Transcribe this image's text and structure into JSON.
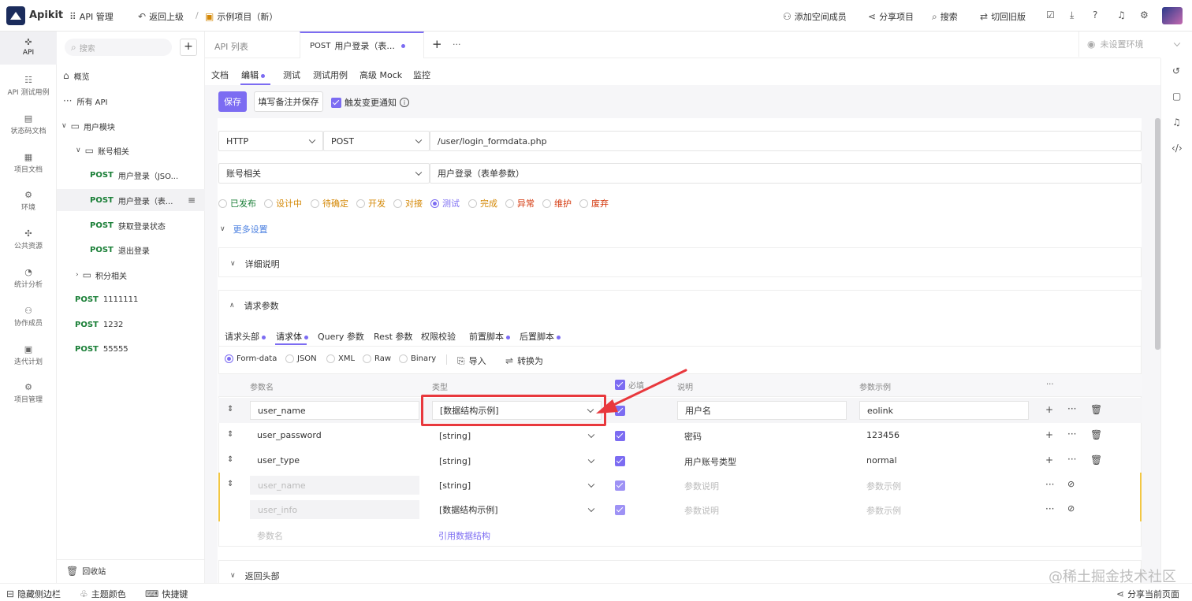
{
  "app": {
    "name": "Apikit"
  },
  "topbar": {
    "api_manage": "API 管理",
    "back": "返回上级",
    "separator": "/",
    "project": "示例项目（新）",
    "add_member": "添加空间成员",
    "share": "分享项目",
    "search": "搜索",
    "old_version": "切回旧版"
  },
  "rail": [
    {
      "label": "API",
      "icon": "api-icon"
    },
    {
      "label": "API 测试用例",
      "icon": "test-case-icon"
    },
    {
      "label": "状态码文档",
      "icon": "doc-icon"
    },
    {
      "label": "项目文档",
      "icon": "word-icon"
    },
    {
      "label": "环境",
      "icon": "env-icon"
    },
    {
      "label": "公共资源",
      "icon": "puzzle-icon"
    },
    {
      "label": "统计分析",
      "icon": "pie-chart-icon"
    },
    {
      "label": "协作成员",
      "icon": "users-icon"
    },
    {
      "label": "迭代计划",
      "icon": "calendar-icon"
    },
    {
      "label": "项目管理",
      "icon": "gear-icon"
    }
  ],
  "tree": {
    "search_placeholder": "搜索",
    "overview": "概览",
    "all_api": "所有 API",
    "user_module": "用户模块",
    "account": "账号相关",
    "method": "POST",
    "items": [
      "用户登录（JSO...",
      "用户登录（表...",
      "获取登录状态",
      "退出登录"
    ],
    "points": "积分相关",
    "root_items": [
      "1111111",
      "1232",
      "55555"
    ],
    "recycle": "回收站"
  },
  "tabs": {
    "api_list": "API 列表",
    "active_method": "POST",
    "active_title": "用户登录（表...",
    "plus": "+",
    "more": "···",
    "env": "未设置环境"
  },
  "subtabs": [
    "文档",
    "编辑",
    "测试",
    "测试用例",
    "高级 Mock",
    "监控"
  ],
  "actions": {
    "save": "保存",
    "save_note": "填写备注并保存",
    "notify": "触发变更通知"
  },
  "request": {
    "protocol": "HTTP",
    "method": "POST",
    "url": "/user/login_formdata.php",
    "group": "账号相关",
    "name": "用户登录（表单参数）"
  },
  "statuses": [
    {
      "label": "已发布",
      "color": "#1a7f37"
    },
    {
      "label": "设计中",
      "color": "#d48806"
    },
    {
      "label": "待确定",
      "color": "#d48806"
    },
    {
      "label": "开发",
      "color": "#d48806"
    },
    {
      "label": "对接",
      "color": "#d48806"
    },
    {
      "label": "测试",
      "color": "#7c6cf2"
    },
    {
      "label": "完成",
      "color": "#d48806"
    },
    {
      "label": "异常",
      "color": "#d4380d"
    },
    {
      "label": "维护",
      "color": "#d4380d"
    },
    {
      "label": "废弃",
      "color": "#d4380d"
    }
  ],
  "more_settings": "更多设置",
  "detail": "详细说明",
  "params_title": "请求参数",
  "param_tabs": [
    "请求头部",
    "请求体",
    "Query 参数",
    "Rest 参数",
    "权限校验",
    "前置脚本",
    "后置脚本"
  ],
  "body_types": [
    "Form-data",
    "JSON",
    "XML",
    "Raw",
    "Binary"
  ],
  "import": "导入",
  "convert": "转换为",
  "columns": {
    "name": "参数名",
    "type": "类型",
    "required": "必填",
    "desc": "说明",
    "example": "参数示例",
    "more": "···"
  },
  "rows": [
    {
      "name": "user_name",
      "type": "[数据结构示例]",
      "desc": "用户名",
      "example": "eolink"
    },
    {
      "name": "user_password",
      "type": "[string]",
      "desc": "密码",
      "example": "123456"
    },
    {
      "name": "user_type",
      "type": "[string]",
      "desc": "用户账号类型",
      "example": "normal"
    },
    {
      "name": "user_name",
      "type": "[string]",
      "desc": "参数说明",
      "example": "参数示例"
    },
    {
      "name": "user_info",
      "type": "[数据结构示例]",
      "desc": "参数说明",
      "example": "参数示例"
    }
  ],
  "new_param": "参数名",
  "ref_struct": "引用数据结构",
  "response_header": "返回头部",
  "bottom": {
    "hide_sidebar": "隐藏侧边栏",
    "theme": "主题颜色",
    "shortcuts": "快捷键",
    "share_page": "分享当前页面"
  },
  "watermark": "@稀土掘金技术社区",
  "colors": {
    "accent": "#7c6cf2",
    "post": "#1a7f37",
    "highlight": "#e8383d",
    "inherit_bar": "#f2c744"
  }
}
